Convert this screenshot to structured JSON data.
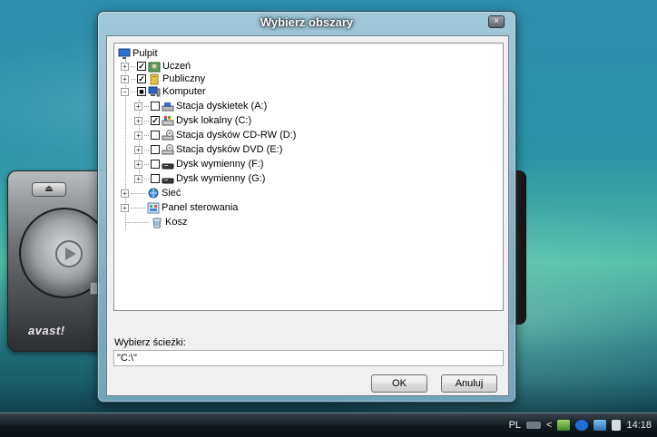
{
  "dialog": {
    "title": "Wybierz obszary",
    "close_glyph": "×",
    "path_label": "Wybierz ścieżki:",
    "path_value": "\"C:\\\"",
    "ok_label": "OK",
    "cancel_label": "Anuluj"
  },
  "tree": {
    "root": "Pulpit",
    "uczen": "Uczeń",
    "publiczny": "Publiczny",
    "komputer": "Komputer",
    "a": "Stacja dyskietek (A:)",
    "c": "Dysk lokalny (C:)",
    "d": "Stacja dysków CD-RW (D:)",
    "e": "Stacja dysków DVD (E:)",
    "f": "Dysk wymienny (F:)",
    "g": "Dysk wymienny (G:)",
    "siec": "Sieć",
    "panel": "Panel sterowania",
    "kosz": "Kosz",
    "expand_plus": "+",
    "expand_minus": "−",
    "check_mark": "✓",
    "partial_mark": "■"
  },
  "avast": {
    "logo": "avast!",
    "eject_glyph": "⏏"
  },
  "taskbar": {
    "language": "PL",
    "chevron": "<",
    "clock": "14:18"
  },
  "colors": {
    "accent": "#2e8fae"
  }
}
